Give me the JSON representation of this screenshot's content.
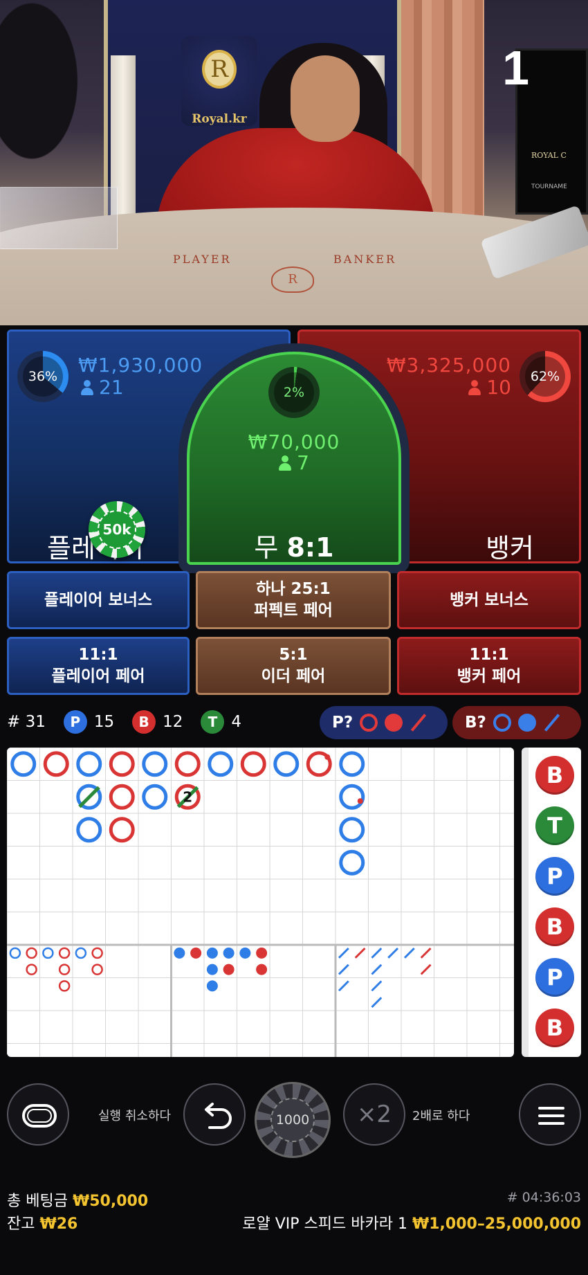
{
  "video": {
    "round_number": "1",
    "crest_text": "Royal.kr",
    "crest_letter": "R",
    "table_left_label": "PLAYER",
    "table_right_label": "BANKER",
    "monitor_text": "ROYAL C",
    "monitor_sub": "TOURNAME"
  },
  "player": {
    "percent": "36%",
    "percent_value": 36,
    "amount": "₩1,930,000",
    "count": "21",
    "name": "플레이어",
    "color": "#2c5fc2"
  },
  "banker": {
    "percent": "62%",
    "percent_value": 62,
    "amount": "₩3,325,000",
    "count": "10",
    "name": "뱅커",
    "color": "#c22b2b"
  },
  "tie": {
    "percent": "2%",
    "percent_value": 2,
    "amount": "₩70,000",
    "count": "7",
    "label": "무",
    "odds": "8:1",
    "color": "#4ad34e"
  },
  "placed_chip": "50k",
  "side_bets": [
    {
      "line1": "플레이어 보너스",
      "line2": ""
    },
    {
      "line1": "하나 25:1",
      "line2": "퍼펙트 페어"
    },
    {
      "line1": "뱅커 보너스",
      "line2": ""
    },
    {
      "line1": "11:1",
      "line2": "플레이어 페어"
    },
    {
      "line1": "5:1",
      "line2": "이더 페어"
    },
    {
      "line1": "11:1",
      "line2": "뱅커 페어"
    }
  ],
  "stats": {
    "round_label": "# 31",
    "p_badge": "P",
    "p_count": "15",
    "b_badge": "B",
    "b_count": "12",
    "t_badge": "T",
    "t_count": "4"
  },
  "predict": {
    "player_label": "P?",
    "banker_label": "B?"
  },
  "last_results": [
    "B",
    "T",
    "P",
    "B",
    "P",
    "B"
  ],
  "controls": {
    "undo_label": "실행 취소하다",
    "chip_value": "1000",
    "double_symbol": "×2",
    "double_label": "2배로 하다"
  },
  "footer": {
    "total_bet_label": "총 베팅금",
    "total_bet_value": "₩50,000",
    "balance_label": "잔고",
    "balance_value": "₩26",
    "game_id": "# 04:36:03",
    "table_name": "로얄 VIP 스피드 바카라 1",
    "limits": "₩1,000–25,000,000"
  }
}
